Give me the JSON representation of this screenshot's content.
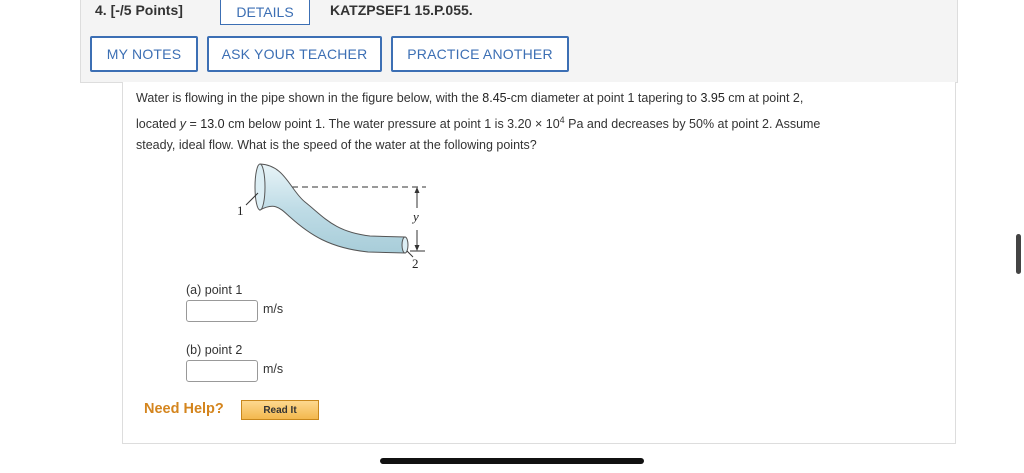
{
  "header": {
    "question_number": "4. [-/5 Points]",
    "details_label": "DETAILS",
    "problem_code": "KATZPSEF1 15.P.055."
  },
  "toolbar": {
    "my_notes": "MY NOTES",
    "ask_teacher": "ASK YOUR TEACHER",
    "practice_another": "PRACTICE ANOTHER"
  },
  "question": {
    "t1": "Water is flowing in the pipe shown in the figure below, with the ",
    "diameter1": "8.45",
    "t2": "-cm diameter at point 1 tapering to ",
    "diameter2": "3.95",
    "t3": " cm at point 2,",
    "t4": "located ",
    "yvar": "y",
    "t5": " = ",
    "yvalue": "13.0",
    "t6": " cm  below point 1. The water pressure at point 1 is 3.20 × 10",
    "exp": "4",
    "t7": " Pa and decreases by 50% at point 2. Assume",
    "t8": "steady, ideal flow. What is the speed of the water at the following points?"
  },
  "figure": {
    "label_point1": "1",
    "label_point2": "2",
    "label_y": "y"
  },
  "parts": [
    {
      "label": "(a) point 1",
      "unit": "m/s",
      "value": ""
    },
    {
      "label": "(b) point 2",
      "unit": "m/s",
      "value": ""
    }
  ],
  "help": {
    "need_help": "Need Help?",
    "read_it": "Read It"
  },
  "colors": {
    "accent": "#3c6fb4",
    "help": "#d4851e",
    "pipe": "#cfe6ee"
  }
}
